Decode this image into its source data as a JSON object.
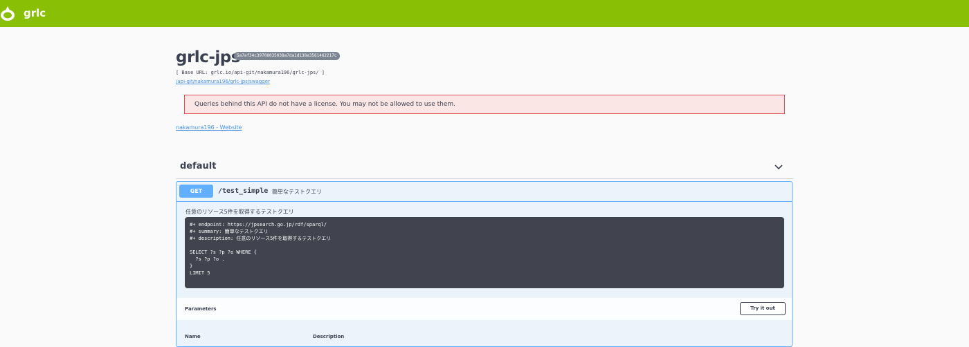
{
  "topbar": {
    "brand": "grlc",
    "color": "#89bf04"
  },
  "api": {
    "title": "grlc-jps",
    "hash": "5a7af34c39708035038a7da1d138e3561462217c",
    "base_url": "[ Base URL: grlc.io/api-git/nakamura196/grlc-jps/ ]",
    "swagger_link": "/api-git/nakamura196/grlc-jps/swagger"
  },
  "license_warning": "Queries behind this API do not have a license. You may not be allowed to use them.",
  "website_link": "nakamura196 - Website",
  "tag": {
    "name": "default",
    "chevron": "chevron-down-icon"
  },
  "operation": {
    "method": "GET",
    "path": "/test_simple",
    "summary": "簡単なテストクエリ",
    "description": "任意のリソース5件を取得するテストクエリ",
    "code": "#+ endpoint: https://jpsearch.go.jp/rdf/sparql/\n#+ summary: 簡単なテストクエリ\n#+ description: 任意のリソース5件を取得するテストクエリ\n\nSELECT ?s ?p ?o WHERE {\n  ?s ?p ?o .\n}\nLIMIT 5",
    "parameters_label": "Parameters",
    "try_it_out_label": "Try it out",
    "columns": [
      "Name",
      "Description"
    ]
  }
}
